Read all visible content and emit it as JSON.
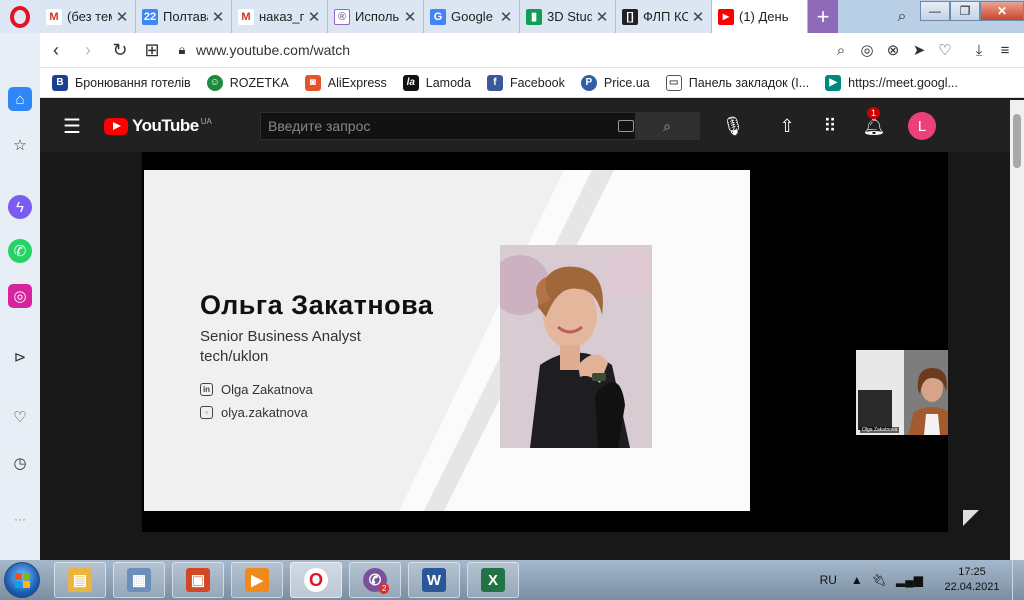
{
  "tabs": [
    {
      "label": "(без тем",
      "icon_text": "M",
      "icon_color": "#d93025"
    },
    {
      "label": "Полтава",
      "icon_text": "22",
      "icon_color": "#4285f4"
    },
    {
      "label": "наказ_п",
      "icon_text": "M",
      "icon_color": "#d93025"
    },
    {
      "label": "Исполь",
      "icon_text": "®",
      "icon_color": "#8e6ab8"
    },
    {
      "label": "Google",
      "icon_text": "G",
      "icon_color": "#4285f4"
    },
    {
      "label": "3D Stud",
      "icon_text": "▮",
      "icon_color": "#0f9d58"
    },
    {
      "label": "ФЛП КС",
      "icon_text": "[]",
      "icon_color": "#222222"
    },
    {
      "label": "(1) День",
      "icon_text": "▶",
      "icon_color": "#ff0000"
    }
  ],
  "address": {
    "url": "www.youtube.com/watch"
  },
  "bookmarks": [
    {
      "label": "Бронювання готелів",
      "icon_text": "B",
      "icon_color": "#1c3f94"
    },
    {
      "label": "ROZETKA",
      "icon_text": "☺",
      "icon_color": "#1a8b3b"
    },
    {
      "label": "AliExpress",
      "icon_text": "◙",
      "icon_color": "#e6532a"
    },
    {
      "label": "Lamoda",
      "icon_text": "la",
      "icon_color": "#111111"
    },
    {
      "label": "Facebook",
      "icon_text": "f",
      "icon_color": "#3b5998"
    },
    {
      "label": "Price.ua",
      "icon_text": "P",
      "icon_color": "#2f5fa8"
    },
    {
      "label": "Панель закладок (I...",
      "icon_text": "▭",
      "icon_color": "#555555"
    },
    {
      "label": "https://meet.googl...",
      "icon_text": "▶",
      "icon_color": "#00897b"
    }
  ],
  "youtube": {
    "logo_text": "YouTube",
    "country_code": "UA",
    "search_placeholder": "Введите запрос",
    "notif_count": "1",
    "avatar_letter": "L"
  },
  "slide": {
    "name": "Ольга  Закатнова",
    "role": "Senior Business Analyst",
    "company": "tech/uklon",
    "linkedin": "Olga Zakatnova",
    "instagram": "olya.zakatnova"
  },
  "webcam": {
    "label": "Olga Zakatnova"
  },
  "taskbar": {
    "apps": [
      {
        "name": "explorer",
        "icon_color": "#e8b640",
        "icon_text": "▤"
      },
      {
        "name": "calculator",
        "icon_color": "#6b8fb8",
        "icon_text": "▦"
      },
      {
        "name": "powerpoint",
        "icon_color": "#d24726",
        "icon_text": "▣"
      },
      {
        "name": "media-player",
        "icon_color": "#f08a1c",
        "icon_text": "▶"
      },
      {
        "name": "opera",
        "icon_color": "#e41222",
        "icon_text": "O"
      },
      {
        "name": "viber",
        "icon_color": "#7b519d",
        "icon_text": "✆",
        "badge": "2"
      },
      {
        "name": "word",
        "icon_color": "#2b579a",
        "icon_text": "W"
      },
      {
        "name": "excel",
        "icon_color": "#217346",
        "icon_text": "X"
      }
    ],
    "language": "RU",
    "time": "17:25",
    "date": "22.04.2021"
  }
}
